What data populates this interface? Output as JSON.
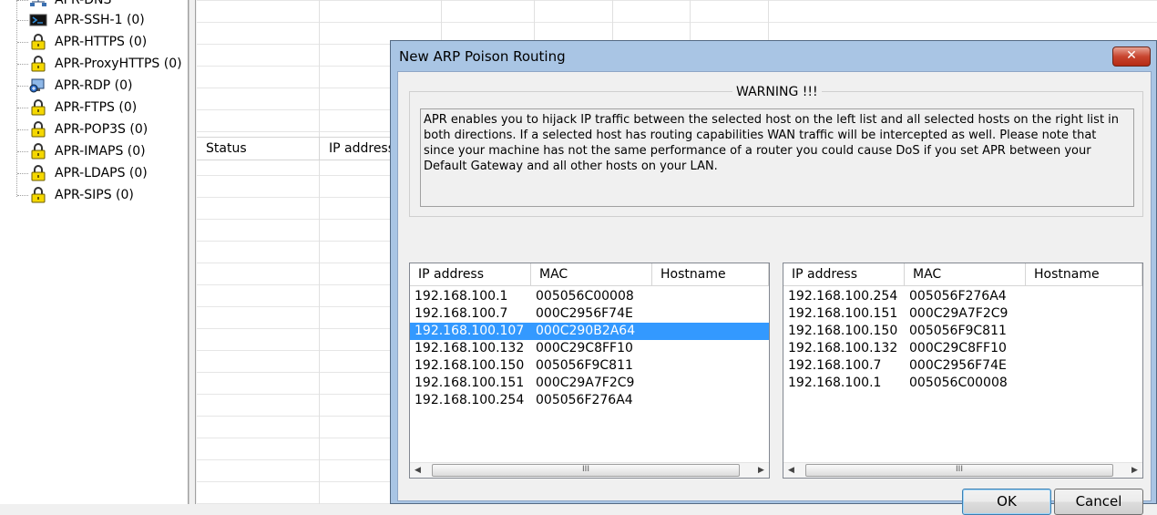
{
  "tree": {
    "items": [
      {
        "label": "APR-DNS",
        "icon": "network-icon"
      },
      {
        "label": "APR-SSH-1 (0)",
        "icon": "terminal-icon"
      },
      {
        "label": "APR-HTTPS (0)",
        "icon": "lock-icon"
      },
      {
        "label": "APR-ProxyHTTPS (0)",
        "icon": "lock-icon"
      },
      {
        "label": "APR-RDP (0)",
        "icon": "remote-desktop-icon"
      },
      {
        "label": "APR-FTPS (0)",
        "icon": "lock-icon"
      },
      {
        "label": "APR-POP3S (0)",
        "icon": "lock-icon"
      },
      {
        "label": "APR-IMAPS (0)",
        "icon": "lock-icon"
      },
      {
        "label": "APR-LDAPS (0)",
        "icon": "lock-icon"
      },
      {
        "label": "APR-SIPS (0)",
        "icon": "lock-icon"
      }
    ]
  },
  "background_table": {
    "columns": [
      "Status",
      "IP address"
    ]
  },
  "dialog": {
    "title": "New ARP Poison Routing",
    "close_label": "✕",
    "warning_title": "WARNING !!!",
    "warning_text": "APR enables you to hijack IP traffic between the selected host on the left list and all selected hosts on the right list in both directions. If a selected host has routing capabilities WAN traffic will be intercepted as well. Please note that since your machine has not the same performance of a router you could cause DoS if you set APR between your Default Gateway and all other hosts on your LAN.",
    "left_list": {
      "columns": [
        "IP address",
        "MAC",
        "Hostname"
      ],
      "rows": [
        {
          "ip": "192.168.100.1",
          "mac": "005056C00008",
          "host": ""
        },
        {
          "ip": "192.168.100.7",
          "mac": "000C2956F74E",
          "host": ""
        },
        {
          "ip": "192.168.100.107",
          "mac": "000C290B2A64",
          "host": "",
          "selected": true
        },
        {
          "ip": "192.168.100.132",
          "mac": "000C29C8FF10",
          "host": ""
        },
        {
          "ip": "192.168.100.150",
          "mac": "005056F9C811",
          "host": ""
        },
        {
          "ip": "192.168.100.151",
          "mac": "000C29A7F2C9",
          "host": ""
        },
        {
          "ip": "192.168.100.254",
          "mac": "005056F276A4",
          "host": ""
        }
      ]
    },
    "right_list": {
      "columns": [
        "IP address",
        "MAC",
        "Hostname"
      ],
      "rows": [
        {
          "ip": "192.168.100.254",
          "mac": "005056F276A4",
          "host": ""
        },
        {
          "ip": "192.168.100.151",
          "mac": "000C29A7F2C9",
          "host": ""
        },
        {
          "ip": "192.168.100.150",
          "mac": "005056F9C811",
          "host": ""
        },
        {
          "ip": "192.168.100.132",
          "mac": "000C29C8FF10",
          "host": ""
        },
        {
          "ip": "192.168.100.7",
          "mac": "000C2956F74E",
          "host": ""
        },
        {
          "ip": "192.168.100.1",
          "mac": "005056C00008",
          "host": ""
        }
      ]
    },
    "scroll_thumb_glyph": "III",
    "ok_label": "OK",
    "cancel_label": "Cancel"
  }
}
